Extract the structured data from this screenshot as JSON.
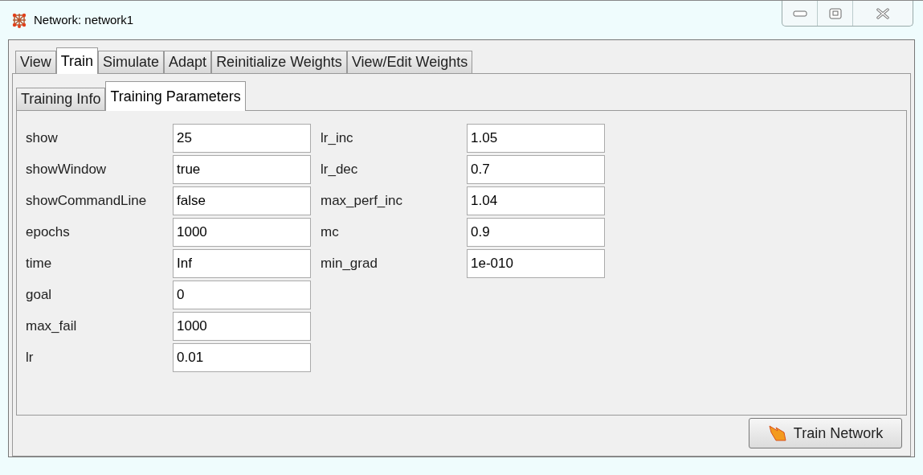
{
  "window": {
    "title": "Network: network1"
  },
  "tabs": [
    {
      "label": "View",
      "selected": false
    },
    {
      "label": "Train",
      "selected": true
    },
    {
      "label": "Simulate",
      "selected": false
    },
    {
      "label": "Adapt",
      "selected": false
    },
    {
      "label": "Reinitialize Weights",
      "selected": false
    },
    {
      "label": "View/Edit Weights",
      "selected": false
    }
  ],
  "subtabs": [
    {
      "label": "Training Info",
      "selected": false
    },
    {
      "label": "Training Parameters",
      "selected": true
    }
  ],
  "parameters_left": [
    {
      "label": "show",
      "value": "25"
    },
    {
      "label": "showWindow",
      "value": "true"
    },
    {
      "label": "showCommandLine",
      "value": "false"
    },
    {
      "label": "epochs",
      "value": "1000"
    },
    {
      "label": "time",
      "value": "Inf"
    },
    {
      "label": "goal",
      "value": "0"
    },
    {
      "label": "max_fail",
      "value": "1000"
    },
    {
      "label": "lr",
      "value": "0.01"
    }
  ],
  "parameters_right": [
    {
      "label": "lr_inc",
      "value": "1.05"
    },
    {
      "label": "lr_dec",
      "value": "0.7"
    },
    {
      "label": "max_perf_inc",
      "value": "1.04"
    },
    {
      "label": "mc",
      "value": "0.9"
    },
    {
      "label": "min_grad",
      "value": "1e-010"
    }
  ],
  "train_button": "Train Network"
}
